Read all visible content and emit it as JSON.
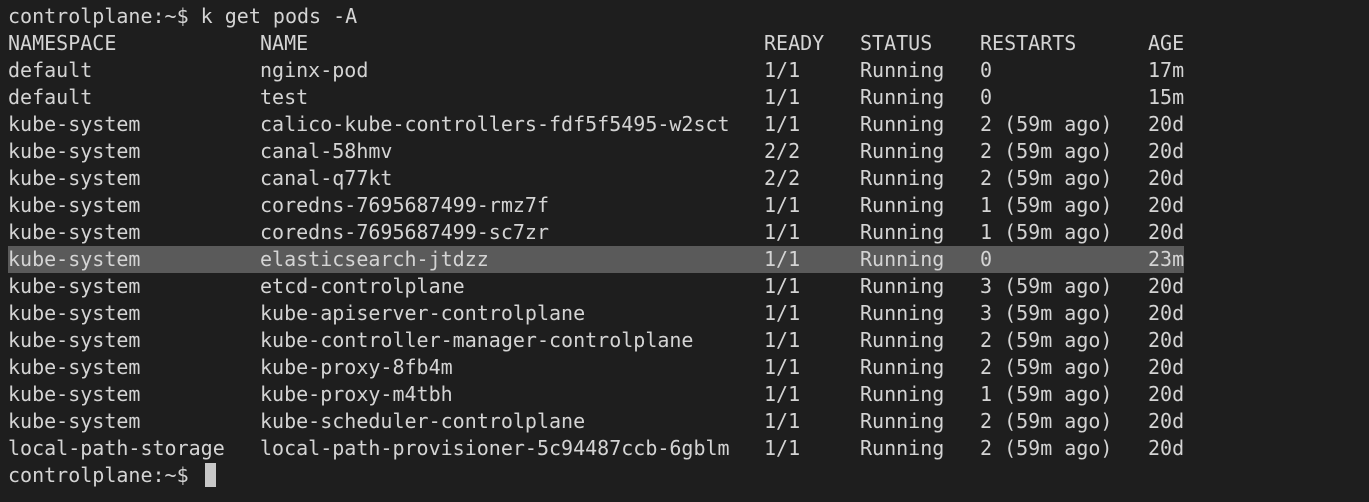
{
  "terminal": {
    "prompt": "controlplane:~$",
    "command": "k get pods -A",
    "headers": {
      "namespace": "NAMESPACE",
      "name": "NAME",
      "ready": "READY",
      "status": "STATUS",
      "restarts": "RESTARTS",
      "age": "AGE"
    },
    "rows": [
      {
        "namespace": "default",
        "name": "nginx-pod",
        "ready": "1/1",
        "status": "Running",
        "restarts": "0",
        "age": "17m"
      },
      {
        "namespace": "default",
        "name": "test",
        "ready": "1/1",
        "status": "Running",
        "restarts": "0",
        "age": "15m"
      },
      {
        "namespace": "kube-system",
        "name": "calico-kube-controllers-fdf5f5495-w2sct",
        "ready": "1/1",
        "status": "Running",
        "restarts": "2 (59m ago)",
        "age": "20d"
      },
      {
        "namespace": "kube-system",
        "name": "canal-58hmv",
        "ready": "2/2",
        "status": "Running",
        "restarts": "2 (59m ago)",
        "age": "20d"
      },
      {
        "namespace": "kube-system",
        "name": "canal-q77kt",
        "ready": "2/2",
        "status": "Running",
        "restarts": "2 (59m ago)",
        "age": "20d"
      },
      {
        "namespace": "kube-system",
        "name": "coredns-7695687499-rmz7f",
        "ready": "1/1",
        "status": "Running",
        "restarts": "1 (59m ago)",
        "age": "20d"
      },
      {
        "namespace": "kube-system",
        "name": "coredns-7695687499-sc7zr",
        "ready": "1/1",
        "status": "Running",
        "restarts": "1 (59m ago)",
        "age": "20d"
      },
      {
        "namespace": "kube-system",
        "name": "elasticsearch-jtdzz",
        "ready": "1/1",
        "status": "Running",
        "restarts": "0",
        "age": "23m",
        "highlighted": true
      },
      {
        "namespace": "kube-system",
        "name": "etcd-controlplane",
        "ready": "1/1",
        "status": "Running",
        "restarts": "3 (59m ago)",
        "age": "20d"
      },
      {
        "namespace": "kube-system",
        "name": "kube-apiserver-controlplane",
        "ready": "1/1",
        "status": "Running",
        "restarts": "3 (59m ago)",
        "age": "20d"
      },
      {
        "namespace": "kube-system",
        "name": "kube-controller-manager-controlplane",
        "ready": "1/1",
        "status": "Running",
        "restarts": "2 (59m ago)",
        "age": "20d"
      },
      {
        "namespace": "kube-system",
        "name": "kube-proxy-8fb4m",
        "ready": "1/1",
        "status": "Running",
        "restarts": "2 (59m ago)",
        "age": "20d"
      },
      {
        "namespace": "kube-system",
        "name": "kube-proxy-m4tbh",
        "ready": "1/1",
        "status": "Running",
        "restarts": "1 (59m ago)",
        "age": "20d"
      },
      {
        "namespace": "kube-system",
        "name": "kube-scheduler-controlplane",
        "ready": "1/1",
        "status": "Running",
        "restarts": "2 (59m ago)",
        "age": "20d"
      },
      {
        "namespace": "local-path-storage",
        "name": "local-path-provisioner-5c94487ccb-6gblm",
        "ready": "1/1",
        "status": "Running",
        "restarts": "2 (59m ago)",
        "age": "20d"
      }
    ],
    "colors": {
      "background": "#1e1e1e",
      "text": "#d4d4d4",
      "highlight": "#5a5a5a",
      "cursor": "#c8c8c8"
    }
  }
}
